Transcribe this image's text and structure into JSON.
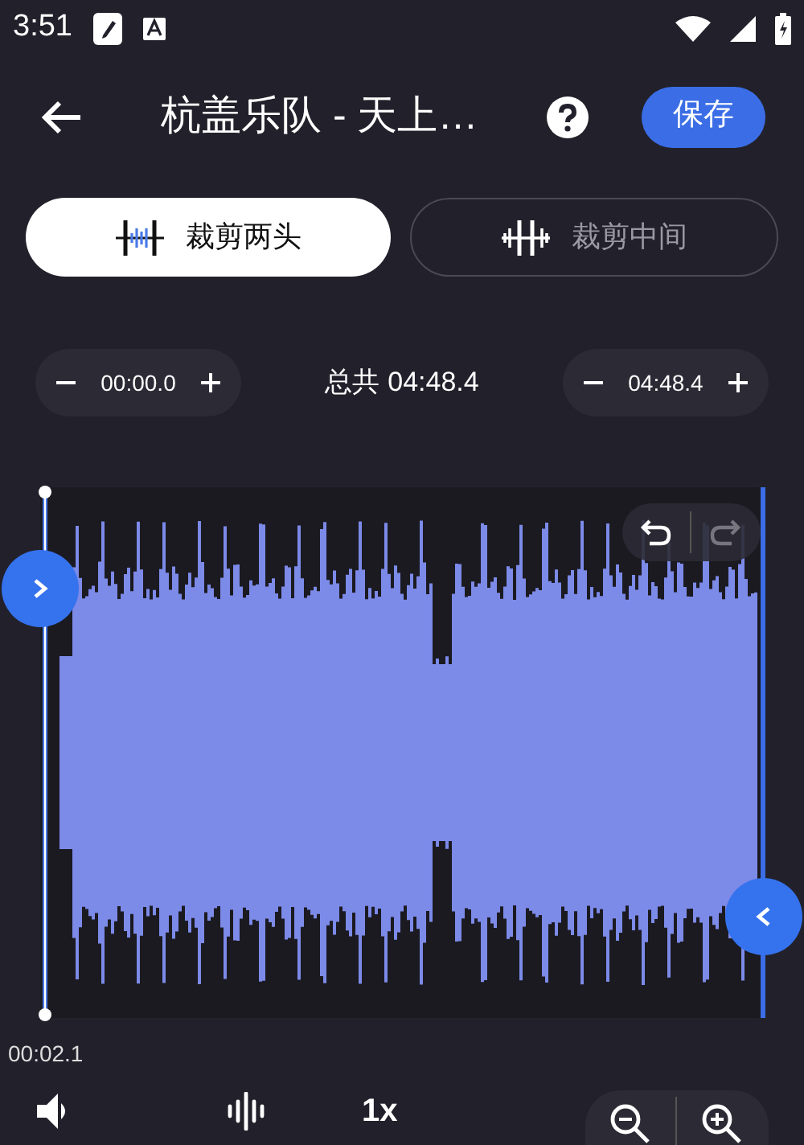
{
  "status_bar": {
    "time": "3:51"
  },
  "header": {
    "title": "杭盖乐队 - 天上…",
    "save": "保存"
  },
  "tabs": [
    {
      "label": "裁剪两头",
      "kind": "trim_sides",
      "selected": true
    },
    {
      "label": "裁剪中间",
      "kind": "trim_middle",
      "selected": false
    }
  ],
  "trim": {
    "start": "00:00.0",
    "total_label": "总共",
    "total": "04:48.4",
    "end": "04:48.4"
  },
  "history": {
    "undo": {
      "disabled": false
    },
    "redo": {
      "disabled": true
    }
  },
  "playhead_time": "00:02.1",
  "toolbar": {
    "speed": "1x"
  }
}
